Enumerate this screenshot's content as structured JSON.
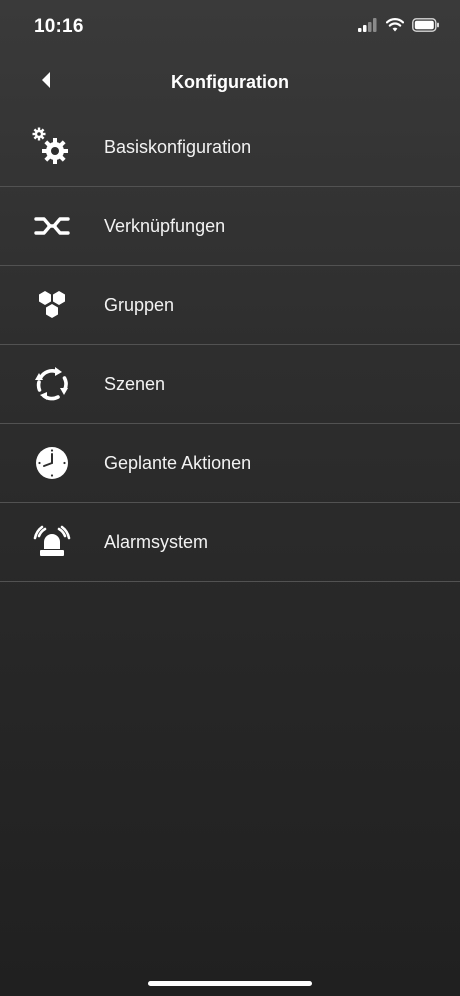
{
  "status_bar": {
    "time": "10:16"
  },
  "nav": {
    "title": "Konfiguration"
  },
  "menu": {
    "items": [
      {
        "label": "Basiskonfiguration",
        "icon": "gears-icon"
      },
      {
        "label": "Verknüpfungen",
        "icon": "link-icon"
      },
      {
        "label": "Gruppen",
        "icon": "hexagons-icon"
      },
      {
        "label": "Szenen",
        "icon": "cycle-arrows-icon"
      },
      {
        "label": "Geplante Aktionen",
        "icon": "clock-icon"
      },
      {
        "label": "Alarmsystem",
        "icon": "alarm-siren-icon"
      }
    ]
  },
  "colors": {
    "background_top": "#3a3a3a",
    "background_bottom": "#202020",
    "divider": "#525252",
    "text": "#ffffff"
  }
}
